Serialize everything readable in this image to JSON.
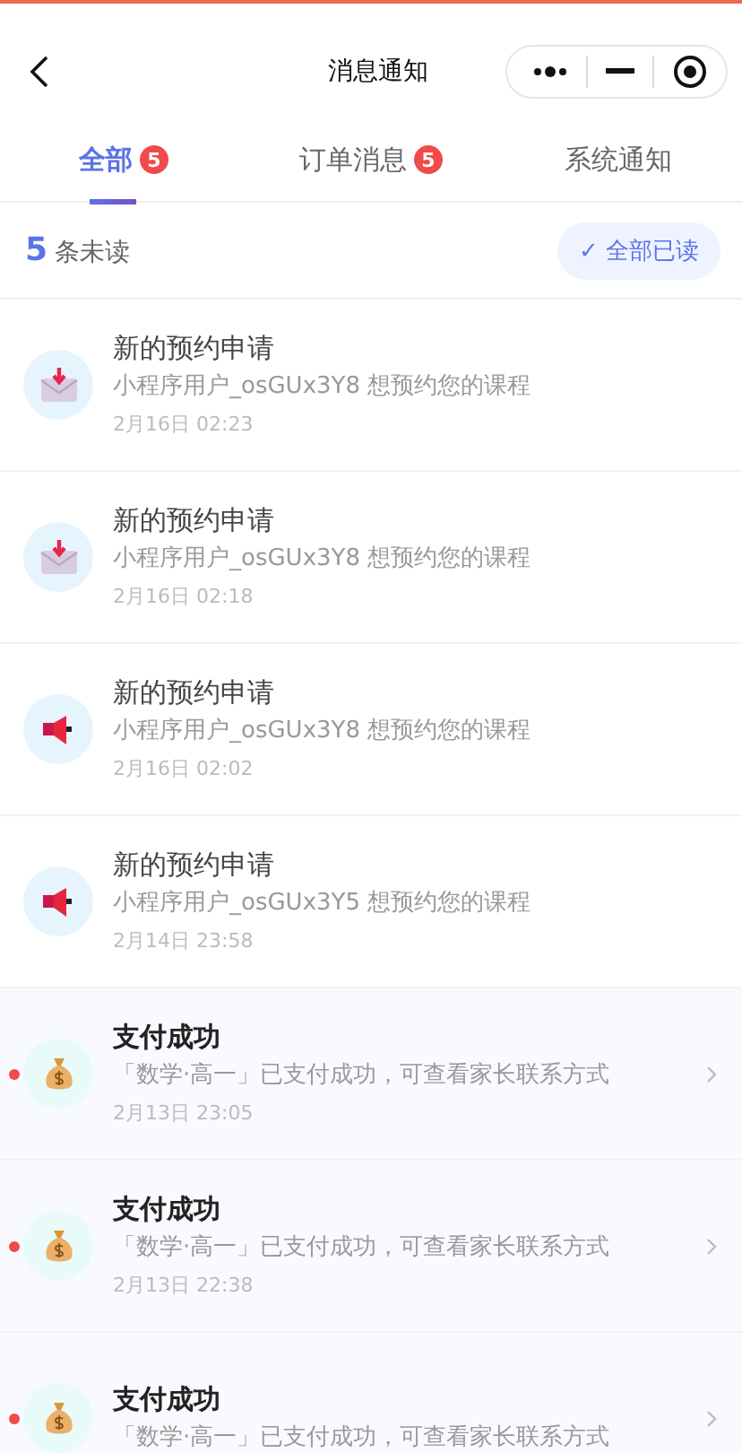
{
  "nav": {
    "title": "消息通知"
  },
  "tabs": [
    {
      "label": "全部",
      "badge": "5",
      "selected": true
    },
    {
      "label": "订单消息",
      "badge": "5",
      "selected": false
    },
    {
      "label": "系统通知",
      "selected": false
    }
  ],
  "summary": {
    "count": "5",
    "label": "条未读",
    "button": "✓ 全部已读"
  },
  "messages": [
    {
      "kind": "mail",
      "title": "新的预约申请",
      "text": "小程序用户_osGUx3Y8 想预约您的课程",
      "time": "2月16日 02:23",
      "unread": false
    },
    {
      "kind": "mail",
      "title": "新的预约申请",
      "text": "小程序用户_osGUx3Y8 想预约您的课程",
      "time": "2月16日 02:18",
      "unread": false
    },
    {
      "kind": "megaphone",
      "title": "新的预约申请",
      "text": "小程序用户_osGUx3Y8 想预约您的课程",
      "time": "2月16日 02:02",
      "unread": false
    },
    {
      "kind": "megaphone",
      "title": "新的预约申请",
      "text": "小程序用户_osGUx3Y5 想预约您的课程",
      "time": "2月14日 23:58",
      "unread": false
    },
    {
      "kind": "money",
      "title": "支付成功",
      "text": "「数学·高一」已支付成功，可查看家长联系方式",
      "time": "2月13日 23:05",
      "unread": true
    },
    {
      "kind": "money",
      "title": "支付成功",
      "text": "「数学·高一」已支付成功，可查看家长联系方式",
      "time": "2月13日 22:38",
      "unread": true
    },
    {
      "kind": "money",
      "title": "支付成功",
      "text": "「数学·高一」已支付成功，可查看家长联系方式",
      "unread": true
    }
  ]
}
